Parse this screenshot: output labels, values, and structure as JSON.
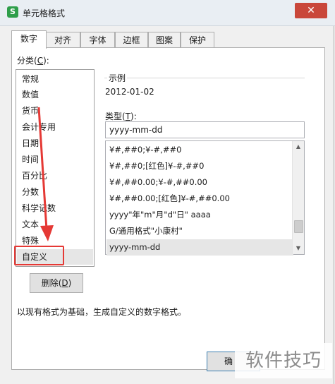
{
  "window": {
    "app_icon_glyph": "S",
    "title": "单元格格式",
    "close_glyph": "✕"
  },
  "tabs": [
    {
      "label": "数字",
      "active": true
    },
    {
      "label": "对齐",
      "active": false
    },
    {
      "label": "字体",
      "active": false
    },
    {
      "label": "边框",
      "active": false
    },
    {
      "label": "图案",
      "active": false
    },
    {
      "label": "保护",
      "active": false
    }
  ],
  "category": {
    "label_prefix": "分类(",
    "label_key": "C",
    "label_suffix": "):",
    "items": [
      "常规",
      "数值",
      "货币",
      "会计专用",
      "日期",
      "时间",
      "百分比",
      "分数",
      "科学记数",
      "文本",
      "特殊",
      "自定义"
    ],
    "selected": "自定义"
  },
  "sample": {
    "label": "示例",
    "value": "2012-01-02"
  },
  "type": {
    "label_prefix": "类型(",
    "label_key": "T",
    "label_suffix": "):",
    "value": "yyyy-mm-dd",
    "formats": [
      "¥#,##0;¥-#,##0",
      "¥#,##0;[红色]¥-#,##0",
      "¥#,##0.00;¥-#,##0.00",
      "¥#,##0.00;[红色]¥-#,##0.00",
      "yyyy\"年\"m\"月\"d\"日\" aaaa",
      "G/通用格式\"小康村\"",
      "yyyy-mm-dd"
    ],
    "selected": "yyyy-mm-dd"
  },
  "delete_button": {
    "label_prefix": "删除(",
    "label_key": "D",
    "label_suffix": ")"
  },
  "description": "以现有格式为基础，生成自定义的数字格式。",
  "ok_button": {
    "label": "确"
  },
  "watermark": "软件技巧",
  "colors": {
    "annotation": "#e53935",
    "app_icon": "#2e9e4a",
    "close_button": "#c9473a",
    "selection": "#e6e6e6"
  }
}
